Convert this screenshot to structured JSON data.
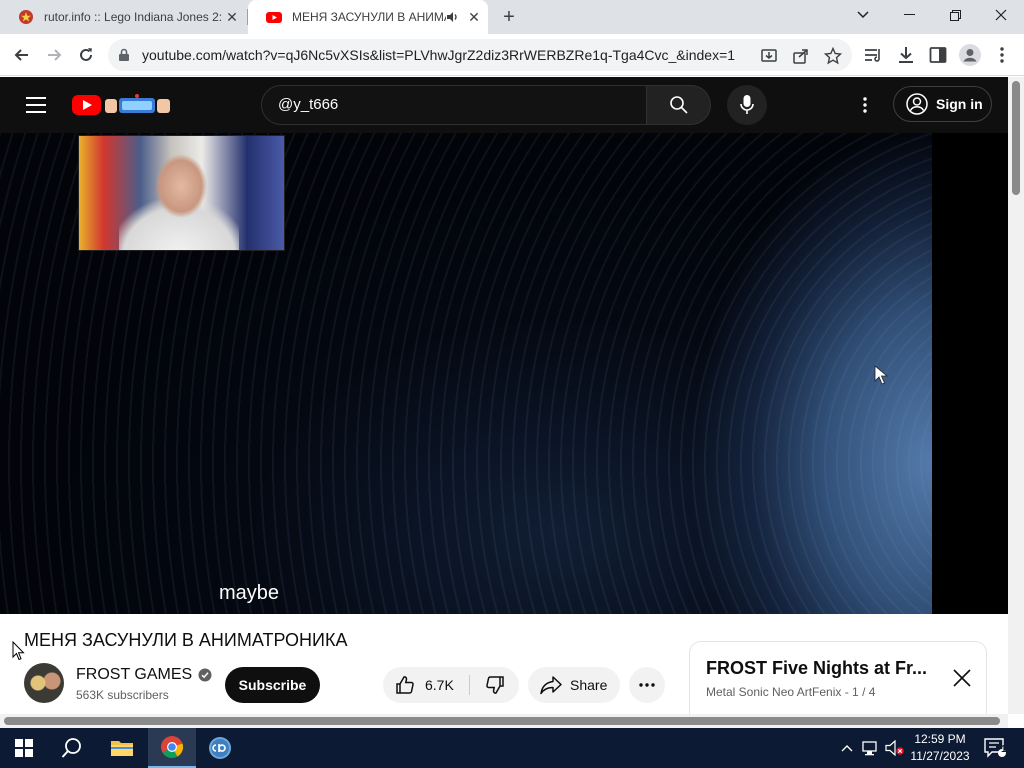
{
  "browser": {
    "tabs": [
      {
        "title": "rutor.info :: Lego Indiana Jones 2:",
        "active": false
      },
      {
        "title": "МЕНЯ ЗАСУНУЛИ В АНИМА",
        "active": true
      }
    ],
    "url": "youtube.com/watch?v=qJ6Nc5vXSIs&list=PLVhwJgrZ2diz3RrWERBZRe1q-Tga4Cvc_&index=1",
    "colors": {
      "tabstrip": "#dee1e6",
      "omnibox": "#f1f3f4"
    }
  },
  "youtube": {
    "search_query": "@y_t666",
    "sign_in_label": "Sign in",
    "colors": {
      "masthead": "#0f0f0f",
      "logo_red": "#ff0000"
    }
  },
  "video": {
    "caption": "maybe",
    "title": "МЕНЯ ЗАСУНУЛИ В АНИМАТРОНИКА"
  },
  "channel": {
    "name": "FROST GAMES",
    "subscribers": "563K subscribers",
    "subscribe_label": "Subscribe"
  },
  "actions": {
    "likes": "6.7K",
    "share_label": "Share"
  },
  "playlist": {
    "title": "FROST Five Nights at Fr...",
    "subtitle": "Metal Sonic Neo ArtFenix - 1 / 4"
  },
  "taskbar": {
    "time": "12:59 PM",
    "date": "11/27/2023",
    "notifications": "1",
    "pinned": [
      "start-icon",
      "search-icon",
      "file-explorer-icon",
      "chrome-icon",
      "qbittorrent-icon"
    ],
    "active_app": "chrome-icon"
  }
}
